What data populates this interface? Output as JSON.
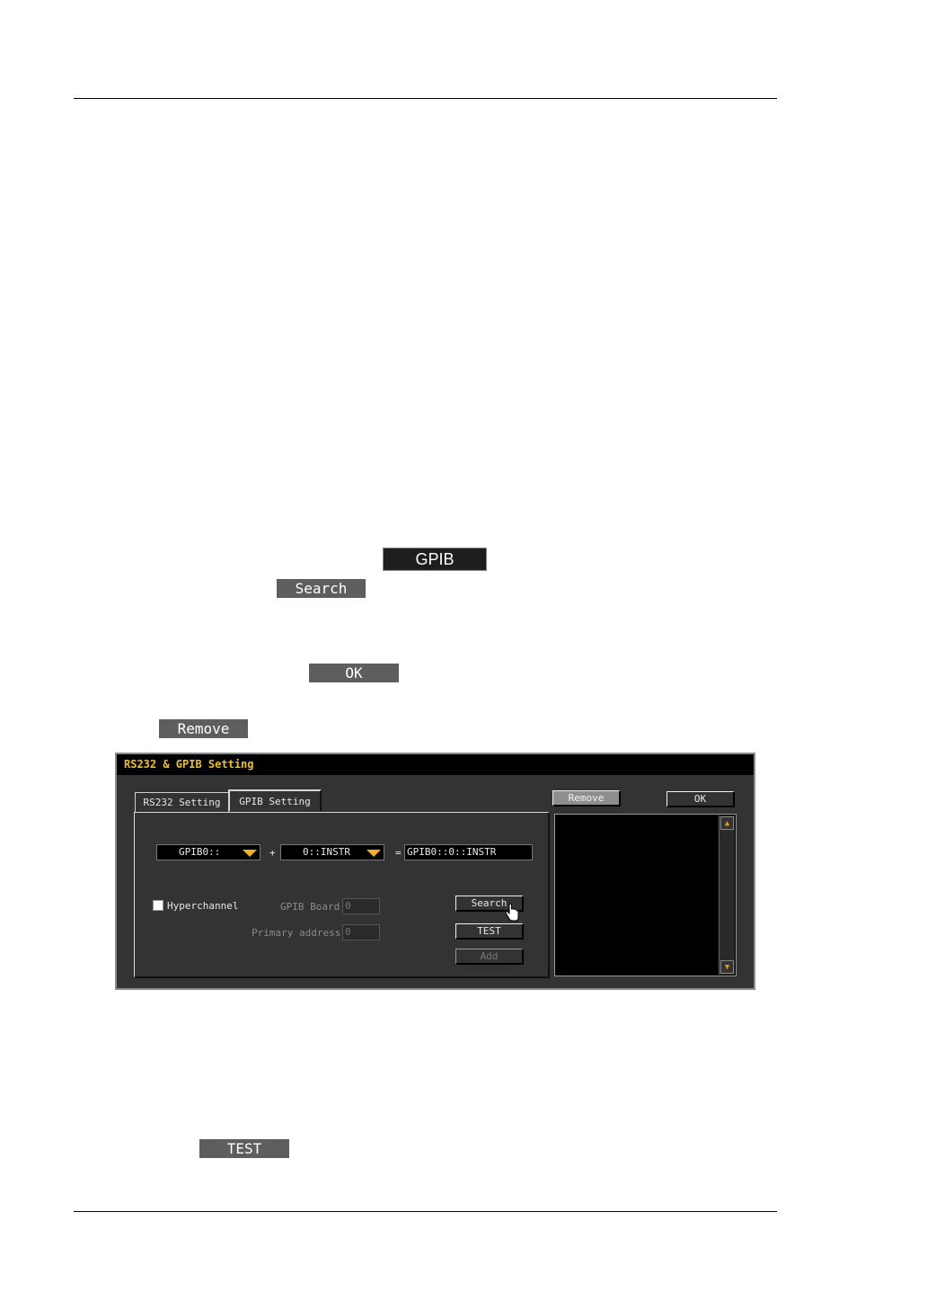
{
  "inline_buttons": {
    "gpib": "GPIB",
    "search": "Search",
    "ok": "OK",
    "remove": "Remove",
    "test": "TEST"
  },
  "dialog": {
    "title": "RS232 & GPIB Setting",
    "tabs": [
      {
        "label": "RS232 Setting",
        "active": false
      },
      {
        "label": "GPIB Setting",
        "active": true
      }
    ],
    "remove_label": "Remove",
    "ok_label": "OK",
    "board_combo": "GPIB0::",
    "plus": "+",
    "address_combo": "0::INSTR",
    "equals": "=",
    "resource": "GPIB0::0::INSTR",
    "hyperchannel_label": "Hyperchannel",
    "hyperchannel_checked": false,
    "gpib_board_label": "GPIB Board",
    "gpib_board_value": "0",
    "primary_address_label": "Primary address",
    "primary_address_value": "0",
    "search_label": "Search",
    "test_label": "TEST",
    "add_label": "Add",
    "accent_color": "#f0b020"
  }
}
